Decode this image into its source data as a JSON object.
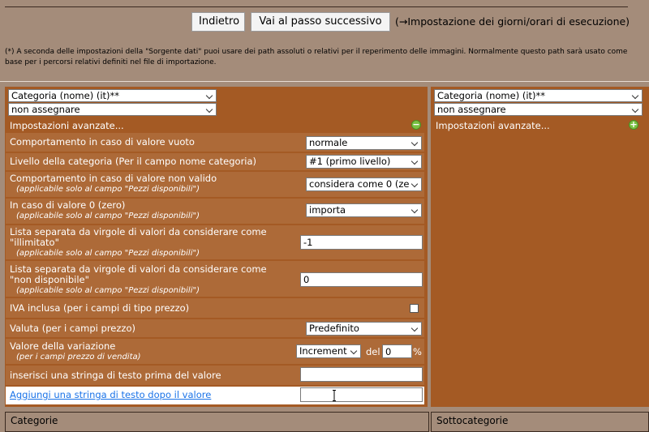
{
  "nav": {
    "back_label": "Indietro",
    "next_label": "Vai al passo successivo",
    "next_note": "(→Impostazione dei giorni/orari di esecuzione)"
  },
  "note": "(*) A seconda delle impostazioni della \"Sorgente dati\" puoi usare dei path assoluti o relativi per il reperimento delle immagini. Normalmente questo path sarà usato come base per i percorsi relativi definiti nel file di importazione.",
  "left": {
    "field_select": "Categoria (nome) (it)**",
    "assign_select": "non assegnare",
    "advanced_label": "Impostazioni avanzate...",
    "collapse_symbol": "−",
    "rows": {
      "empty_behavior": {
        "label": "Comportamento in caso di valore vuoto",
        "value": "normale"
      },
      "category_level": {
        "label": "Livello della categoria (Per il campo nome categoria)",
        "value": "#1 (primo livello)"
      },
      "invalid_value": {
        "label": "Comportamento in caso di valore non valido",
        "sub": "(applicabile solo al campo \"Pezzi disponibili\")",
        "value": "considera come 0 (ze"
      },
      "zero_value": {
        "label": "In caso di valore 0 (zero)",
        "sub": "(applicabile solo al campo \"Pezzi disponibili\")",
        "value": "importa"
      },
      "unlimited_list": {
        "label": "Lista separata da virgole di valori da considerare come",
        "label2": "\"illimitato\"",
        "sub": "(applicabile solo al campo \"Pezzi disponibili\")",
        "value": "-1"
      },
      "unavailable_list": {
        "label": "Lista separata da virgole di valori da considerare come",
        "label2": "\"non disponibile\"",
        "sub": "(applicabile solo al campo \"Pezzi disponibili\")",
        "value": "0"
      },
      "vat_included": {
        "label": "IVA inclusa (per i campi di tipo prezzo)",
        "checked": false
      },
      "currency": {
        "label": "Valuta (per i campi prezzo)",
        "value": "Predefinito"
      },
      "variation": {
        "label": "Valore della variazione",
        "sub": "(per i campi prezzo di vendita)",
        "mode": "Increment",
        "of_label": "del",
        "value": "0",
        "unit": "%"
      },
      "prefix": {
        "label": "inserisci una stringa di testo prima del valore",
        "value": ""
      },
      "suffix": {
        "label": "Aggiungi una stringa di testo dopo il valore",
        "value": ""
      }
    }
  },
  "right": {
    "field_select": "Categoria (nome) (it)**",
    "assign_select": "non assegnare",
    "advanced_label": "Impostazioni avanzate...",
    "expand_symbol": "+"
  },
  "footer": {
    "left_title": "Categorie",
    "right_title": "Sottocategorie"
  }
}
